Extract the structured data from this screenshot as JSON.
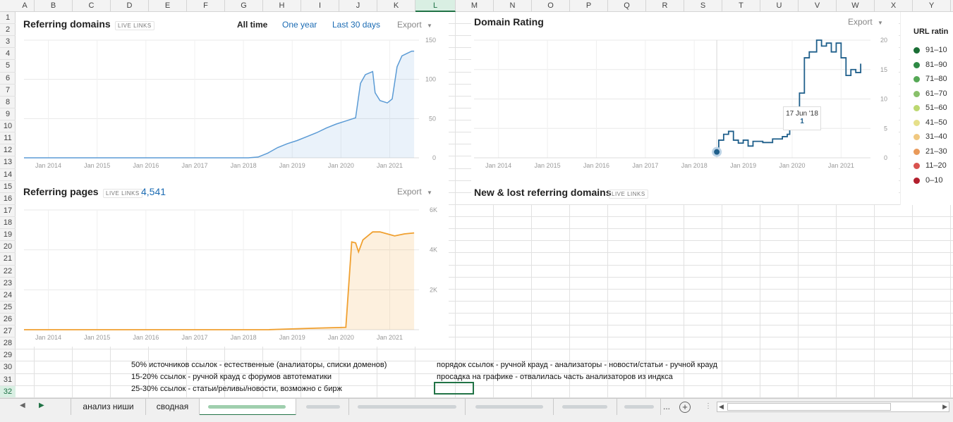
{
  "spreadsheet": {
    "columns": [
      "A",
      "B",
      "C",
      "D",
      "E",
      "F",
      "G",
      "H",
      "I",
      "J",
      "K",
      "L",
      "M",
      "N",
      "O",
      "P",
      "Q",
      "R",
      "S",
      "T",
      "U",
      "V",
      "W",
      "X",
      "Y"
    ],
    "selected_column": "L",
    "rows": [
      "1",
      "2",
      "3",
      "4",
      "5",
      "6",
      "7",
      "8",
      "9",
      "10",
      "11",
      "12",
      "13",
      "14",
      "15",
      "16",
      "17",
      "18",
      "19",
      "20",
      "21",
      "22",
      "23",
      "24",
      "25",
      "26",
      "27",
      "28",
      "29",
      "30",
      "31",
      "32"
    ],
    "selected_row": "32",
    "cells": {
      "d30": "50% источников ссылок - естественные (аналиаторы, списки доменов)",
      "d31": "15-20% ссылок - ручной крауд с форумов автотематики",
      "d32": "25-30% ссылок - статьи/реливы/новости, возможно с бирж",
      "l30": "порядок ссылок - ручной крауд - анализаторы - новости/статьи - ручной крауд",
      "l31": "просадка на графике - отвалилась часть анализаторов из индкса"
    }
  },
  "referring_domains": {
    "title": "Referring domains",
    "badge": "LIVE LINKS",
    "ranges": [
      "All time",
      "One year",
      "Last 30 days"
    ],
    "active_range": "All time",
    "export_label": "Export",
    "chevron_icon": "chevron-down-icon",
    "color": "#5b9bd5"
  },
  "referring_pages": {
    "title": "Referring pages",
    "badge": "LIVE LINKS",
    "count": "4,541",
    "export_label": "Export",
    "color": "#f0a030"
  },
  "domain_rating": {
    "title": "Domain Rating",
    "export_label": "Export",
    "tooltip_date": "17 Jun '18",
    "tooltip_value": "1",
    "color": "#1f5f8b"
  },
  "new_lost": {
    "title": "New & lost referring domains",
    "badge": "LIVE LINKS"
  },
  "url_rating_legend": {
    "title": "URL ratin",
    "items": [
      {
        "label": "91–10",
        "color": "#1a6e35"
      },
      {
        "label": "81–90",
        "color": "#2e8a45"
      },
      {
        "label": "71–80",
        "color": "#55a855"
      },
      {
        "label": "61–70",
        "color": "#88c06a"
      },
      {
        "label": "51–60",
        "color": "#bcd870"
      },
      {
        "label": "41–50",
        "color": "#e6e08a"
      },
      {
        "label": "31–40",
        "color": "#f0c880"
      },
      {
        "label": "21–30",
        "color": "#e99a5a"
      },
      {
        "label": "11–20",
        "color": "#d9534f"
      },
      {
        "label": "0–10",
        "color": "#b21f2d"
      }
    ]
  },
  "sheet_tabs": {
    "tabs": [
      "анализ ниши",
      "сводная"
    ],
    "more": "...",
    "add_icon": "plus-circle-icon"
  },
  "chart_data": [
    {
      "type": "area",
      "title": "Referring domains",
      "x_ticks": [
        "Jan 2014",
        "Jan 2015",
        "Jan 2016",
        "Jan 2017",
        "Jan 2018",
        "Jan 2019",
        "Jan 2020",
        "Jan 2021"
      ],
      "y_ticks": [
        "150",
        "100",
        "50",
        "0"
      ],
      "ylim": [
        0,
        150
      ],
      "xlim": [
        2013.5,
        2021.6
      ],
      "points": [
        [
          2013.5,
          0
        ],
        [
          2018.1,
          0
        ],
        [
          2018.3,
          1
        ],
        [
          2018.5,
          6
        ],
        [
          2018.7,
          13
        ],
        [
          2018.9,
          18
        ],
        [
          2019.1,
          22
        ],
        [
          2019.3,
          27
        ],
        [
          2019.5,
          32
        ],
        [
          2019.7,
          38
        ],
        [
          2019.9,
          43
        ],
        [
          2020.1,
          47
        ],
        [
          2020.3,
          51
        ],
        [
          2020.4,
          95
        ],
        [
          2020.5,
          106
        ],
        [
          2020.65,
          110
        ],
        [
          2020.7,
          83
        ],
        [
          2020.8,
          73
        ],
        [
          2020.95,
          70
        ],
        [
          2021.05,
          75
        ],
        [
          2021.15,
          116
        ],
        [
          2021.25,
          130
        ],
        [
          2021.35,
          133
        ],
        [
          2021.45,
          136
        ],
        [
          2021.5,
          136
        ]
      ],
      "grid": true
    },
    {
      "type": "area",
      "title": "Referring pages",
      "x_ticks": [
        "Jan 2014",
        "Jan 2015",
        "Jan 2016",
        "Jan 2017",
        "Jan 2018",
        "Jan 2019",
        "Jan 2020",
        "Jan 2021"
      ],
      "y_ticks": [
        "6K",
        "4K",
        "2K"
      ],
      "ylim": [
        0,
        6000
      ],
      "xlim": [
        2013.5,
        2021.6
      ],
      "points": [
        [
          2013.5,
          0
        ],
        [
          2018.5,
          0
        ],
        [
          2019.5,
          80
        ],
        [
          2020.1,
          120
        ],
        [
          2020.22,
          4400
        ],
        [
          2020.3,
          4350
        ],
        [
          2020.36,
          3900
        ],
        [
          2020.45,
          4500
        ],
        [
          2020.55,
          4700
        ],
        [
          2020.65,
          4900
        ],
        [
          2020.8,
          4900
        ],
        [
          2020.95,
          4800
        ],
        [
          2021.1,
          4700
        ],
        [
          2021.3,
          4800
        ],
        [
          2021.5,
          4850
        ]
      ],
      "grid": true
    },
    {
      "type": "line",
      "title": "Domain Rating",
      "x_ticks": [
        "Jan 2014",
        "Jan 2015",
        "Jan 2016",
        "Jan 2017",
        "Jan 2018",
        "Jan 2019",
        "Jan 2020",
        "Jan 2021"
      ],
      "y_ticks": [
        "20",
        "15",
        "10",
        "5",
        "0"
      ],
      "ylim": [
        0,
        20
      ],
      "xlim": [
        2013.5,
        2021.6
      ],
      "points": [
        [
          2018.46,
          1
        ],
        [
          2018.5,
          3
        ],
        [
          2018.6,
          4
        ],
        [
          2018.7,
          4.5
        ],
        [
          2018.8,
          3
        ],
        [
          2018.9,
          2.5
        ],
        [
          2019.0,
          3
        ],
        [
          2019.1,
          2
        ],
        [
          2019.2,
          2.8
        ],
        [
          2019.4,
          2.6
        ],
        [
          2019.6,
          3.2
        ],
        [
          2019.8,
          3.6
        ],
        [
          2019.9,
          4
        ],
        [
          2019.95,
          5
        ],
        [
          2020.05,
          5.5
        ],
        [
          2020.1,
          6
        ],
        [
          2020.15,
          11
        ],
        [
          2020.25,
          17
        ],
        [
          2020.35,
          18
        ],
        [
          2020.5,
          20
        ],
        [
          2020.6,
          19
        ],
        [
          2020.7,
          19.5
        ],
        [
          2020.8,
          18
        ],
        [
          2020.9,
          19.5
        ],
        [
          2021.0,
          17
        ],
        [
          2021.1,
          14
        ],
        [
          2021.2,
          15
        ],
        [
          2021.3,
          14.5
        ],
        [
          2021.4,
          16
        ]
      ],
      "tooltip": {
        "date": "17 Jun '18",
        "value": 1
      },
      "grid": true
    }
  ]
}
